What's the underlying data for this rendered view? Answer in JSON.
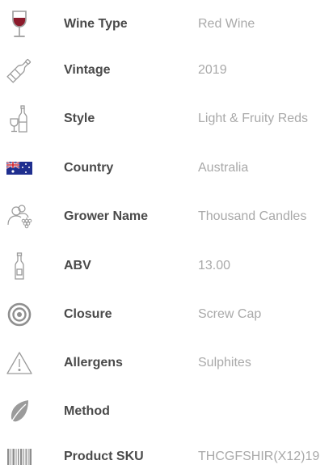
{
  "specs": [
    {
      "icon": "wine-glass-icon",
      "label": "Wine Type",
      "value": "Red Wine"
    },
    {
      "icon": "wine-bottle-icon",
      "label": "Vintage",
      "value": "2019"
    },
    {
      "icon": "bottle-glass-icon",
      "label": "Style",
      "value": "Light & Fruity Reds"
    },
    {
      "icon": "australia-flag-icon",
      "label": "Country",
      "value": "Australia"
    },
    {
      "icon": "grower-people-icon",
      "label": "Grower Name",
      "value": "Thousand Candles"
    },
    {
      "icon": "abv-bottle-icon",
      "label": "ABV",
      "value": "13.00"
    },
    {
      "icon": "closure-target-icon",
      "label": "Closure",
      "value": "Screw Cap"
    },
    {
      "icon": "warning-triangle-icon",
      "label": "Allergens",
      "value": "Sulphites"
    },
    {
      "icon": "leaf-icon",
      "label": "Method",
      "value": ""
    },
    {
      "icon": "barcode-icon",
      "label": "Product SKU",
      "value": "THCGFSHIR(X12)19"
    }
  ],
  "colors": {
    "label": "#4a4a4a",
    "value": "#a9a9a9",
    "icon_outline": "#9b9b9b",
    "wine_red": "#8b1a2b"
  }
}
